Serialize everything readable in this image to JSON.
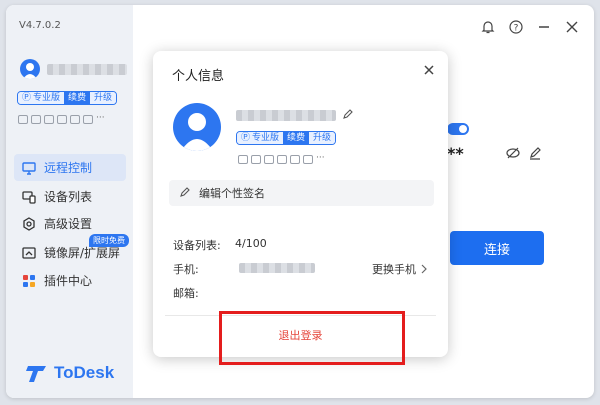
{
  "app": {
    "version": "V4.7.0.2",
    "brand": "ToDesk",
    "accent": "#2d76f0"
  },
  "account_badges": {
    "pro": "专业版",
    "renew": "续费",
    "upgrade": "升级"
  },
  "sidebar": {
    "items": [
      {
        "label": "远程控制",
        "icon": "monitor-icon",
        "active": true
      },
      {
        "label": "设备列表",
        "icon": "devices-icon",
        "active": false
      },
      {
        "label": "高级设置",
        "icon": "gear-icon",
        "active": false
      },
      {
        "label": "镜像屏/扩展屏",
        "icon": "mirror-screen-icon",
        "active": false
      },
      {
        "label": "插件中心",
        "icon": "plugin-icon",
        "active": false
      }
    ],
    "free_tag": "限时免费"
  },
  "background": {
    "password_mask": "**",
    "connect_label": "连接"
  },
  "dialog": {
    "title": "个人信息",
    "edit_signature": "编辑个性签名",
    "device_list_label": "设备列表:",
    "device_list_value": "4/100",
    "phone_label": "手机:",
    "change_phone": "更换手机",
    "email_label": "邮箱:",
    "logout": "退出登录"
  }
}
